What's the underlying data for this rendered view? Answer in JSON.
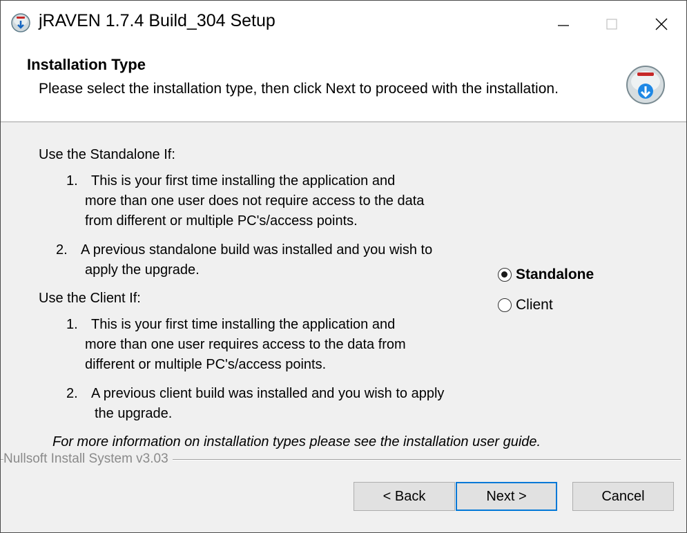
{
  "window": {
    "title": "jRAVEN 1.7.4 Build_304 Setup",
    "controls": {
      "minimize": "minimize",
      "maximize": "maximize",
      "close": "close"
    }
  },
  "header": {
    "title": "Installation Type",
    "subtitle": "Please select the installation type, then click Next to proceed with the installation."
  },
  "content": {
    "standalone_heading": "Use the Standalone If:",
    "standalone_items": [
      {
        "number": "1.",
        "lines": [
          "This is your first time installing the application and",
          "more than one user does not require access to the data",
          "from different or multiple PC's/access points."
        ]
      },
      {
        "number": "2.",
        "lines": [
          "A previous standalone build was installed and you wish to",
          "apply the upgrade."
        ]
      }
    ],
    "client_heading": "Use the Client If:",
    "client_items": [
      {
        "number": "1.",
        "lines": [
          "This is your first time installing the application and",
          "more than one user requires access to the data from",
          "different or multiple PC's/access points."
        ]
      },
      {
        "number": "2.",
        "lines": [
          "A previous client build was installed and you wish to apply",
          "the upgrade."
        ]
      }
    ],
    "note": "For more information on installation types please see the installation user guide."
  },
  "options": {
    "selected": "Standalone",
    "items": [
      "Standalone",
      "Client"
    ]
  },
  "branding": "Nullsoft Install System v3.03",
  "buttons": {
    "back": "< Back",
    "next": "Next >",
    "cancel": "Cancel"
  },
  "colors": {
    "accent": "#0078d7",
    "window_bg": "#f0f0f0",
    "header_bg": "#ffffff"
  },
  "icons": {
    "app": "installer-globe-icon",
    "header": "installer-globe-download-icon"
  }
}
